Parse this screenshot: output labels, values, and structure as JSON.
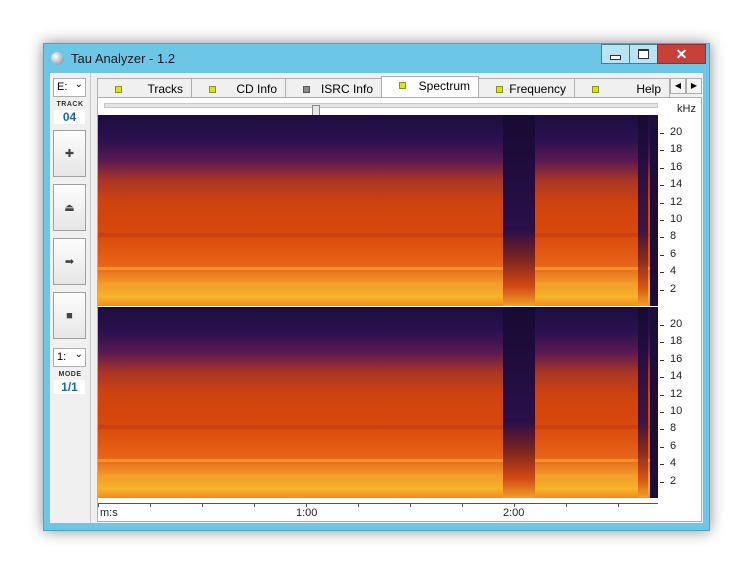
{
  "window": {
    "title": "Tau Analyzer - 1.2",
    "close_glyph": "✕"
  },
  "leftbar": {
    "drive_value": "E:",
    "track_label": "TRACK",
    "track_number": "04",
    "buttons": [
      {
        "name": "plus-icon",
        "glyph": "✚"
      },
      {
        "name": "eject-icon",
        "glyph": "⏏"
      },
      {
        "name": "arrow-right-icon",
        "glyph": "➡"
      },
      {
        "name": "stop-icon",
        "glyph": "■"
      }
    ],
    "mode_value": "1:",
    "mode_label": "MODE",
    "mode_number": "1/1"
  },
  "tabs": [
    {
      "label": "Tracks",
      "led": "yellow",
      "active": false
    },
    {
      "label": "CD Info",
      "led": "yellow",
      "active": false
    },
    {
      "label": "ISRC Info",
      "led": "grey",
      "active": false
    },
    {
      "label": "Spectrum",
      "led": "yellow",
      "active": true
    },
    {
      "label": "Frequency",
      "led": "yellow",
      "active": false
    },
    {
      "label": "Help",
      "led": "yellow",
      "active": false
    }
  ],
  "spectrum": {
    "freq_unit": "kHz",
    "freq_ticks": [
      "20",
      "18",
      "16",
      "14",
      "12",
      "10",
      "8",
      "6",
      "4",
      "2"
    ],
    "time_unit": "m:s",
    "time_labels": [
      "1:00",
      "2:00"
    ],
    "colors": {
      "low": "#1c0d3d",
      "mid": "#d9480b",
      "high": "#f7b42a"
    }
  }
}
